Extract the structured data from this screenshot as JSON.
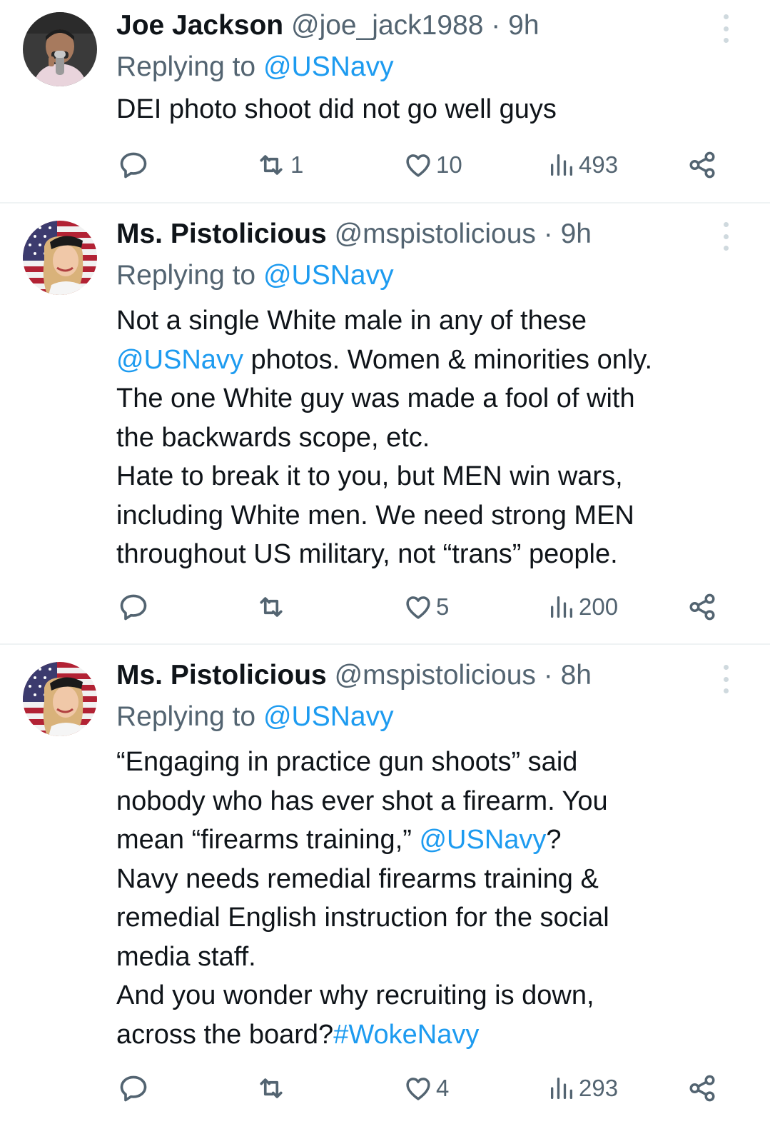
{
  "tweets": [
    {
      "name": "Joe Jackson",
      "handle": "@joe_jack1988",
      "sep": "·",
      "time": "9h",
      "replying_prefix": "Replying to",
      "replying_to": "@USNavy",
      "body": [
        [
          {
            "t": "DEI photo shoot did not go well guys"
          }
        ]
      ],
      "actions": {
        "reply": "",
        "retweet": "1",
        "like": "10",
        "views": "493"
      },
      "avatar_icon": "person-with-microphone-avatar"
    },
    {
      "name": "Ms. Pistolicious",
      "handle": "@mspistolicious",
      "sep": "·",
      "time": "9h",
      "replying_prefix": "Replying to",
      "replying_to": "@USNavy",
      "body": [
        [
          {
            "t": "Not a single White male in any of these"
          }
        ],
        [
          {
            "t": "@USNavy",
            "m": true
          },
          {
            "t": " photos. Women & minorities only."
          }
        ],
        [
          {
            "t": "The one White guy was made a fool of with"
          }
        ],
        [
          {
            "t": "the backwards scope, etc."
          }
        ],
        [
          {
            "t": "Hate to break it to you, but MEN win wars,"
          }
        ],
        [
          {
            "t": "including White men. We need strong MEN"
          }
        ],
        [
          {
            "t": "throughout US military, not “trans” people."
          }
        ]
      ],
      "actions": {
        "reply": "",
        "retweet": "",
        "like": "5",
        "views": "200"
      },
      "avatar_icon": "woman-with-flag-avatar"
    },
    {
      "name": "Ms. Pistolicious",
      "handle": "@mspistolicious",
      "sep": "·",
      "time": "8h",
      "replying_prefix": "Replying to",
      "replying_to": "@USNavy",
      "body": [
        [
          {
            "t": "“Engaging in practice gun shoots” said"
          }
        ],
        [
          {
            "t": "nobody who has ever shot a firearm. You"
          }
        ],
        [
          {
            "t": "mean “firearms training,” "
          },
          {
            "t": "@USNavy",
            "m": true
          },
          {
            "t": "?"
          }
        ],
        [
          {
            "t": "Navy needs remedial firearms training &"
          }
        ],
        [
          {
            "t": "remedial English instruction for the social"
          }
        ],
        [
          {
            "t": "media staff."
          }
        ],
        [
          {
            "t": "And you wonder why recruiting is down,"
          }
        ],
        [
          {
            "t": "across the board?"
          },
          {
            "t": "#WokeNavy",
            "m": true
          }
        ]
      ],
      "actions": {
        "reply": "",
        "retweet": "",
        "like": "4",
        "views": "293"
      },
      "avatar_icon": "woman-with-flag-avatar"
    }
  ],
  "colors": {
    "text": "#0f1419",
    "secondary": "#536471",
    "link": "#1d9bf0",
    "divider": "#eff3f4"
  }
}
